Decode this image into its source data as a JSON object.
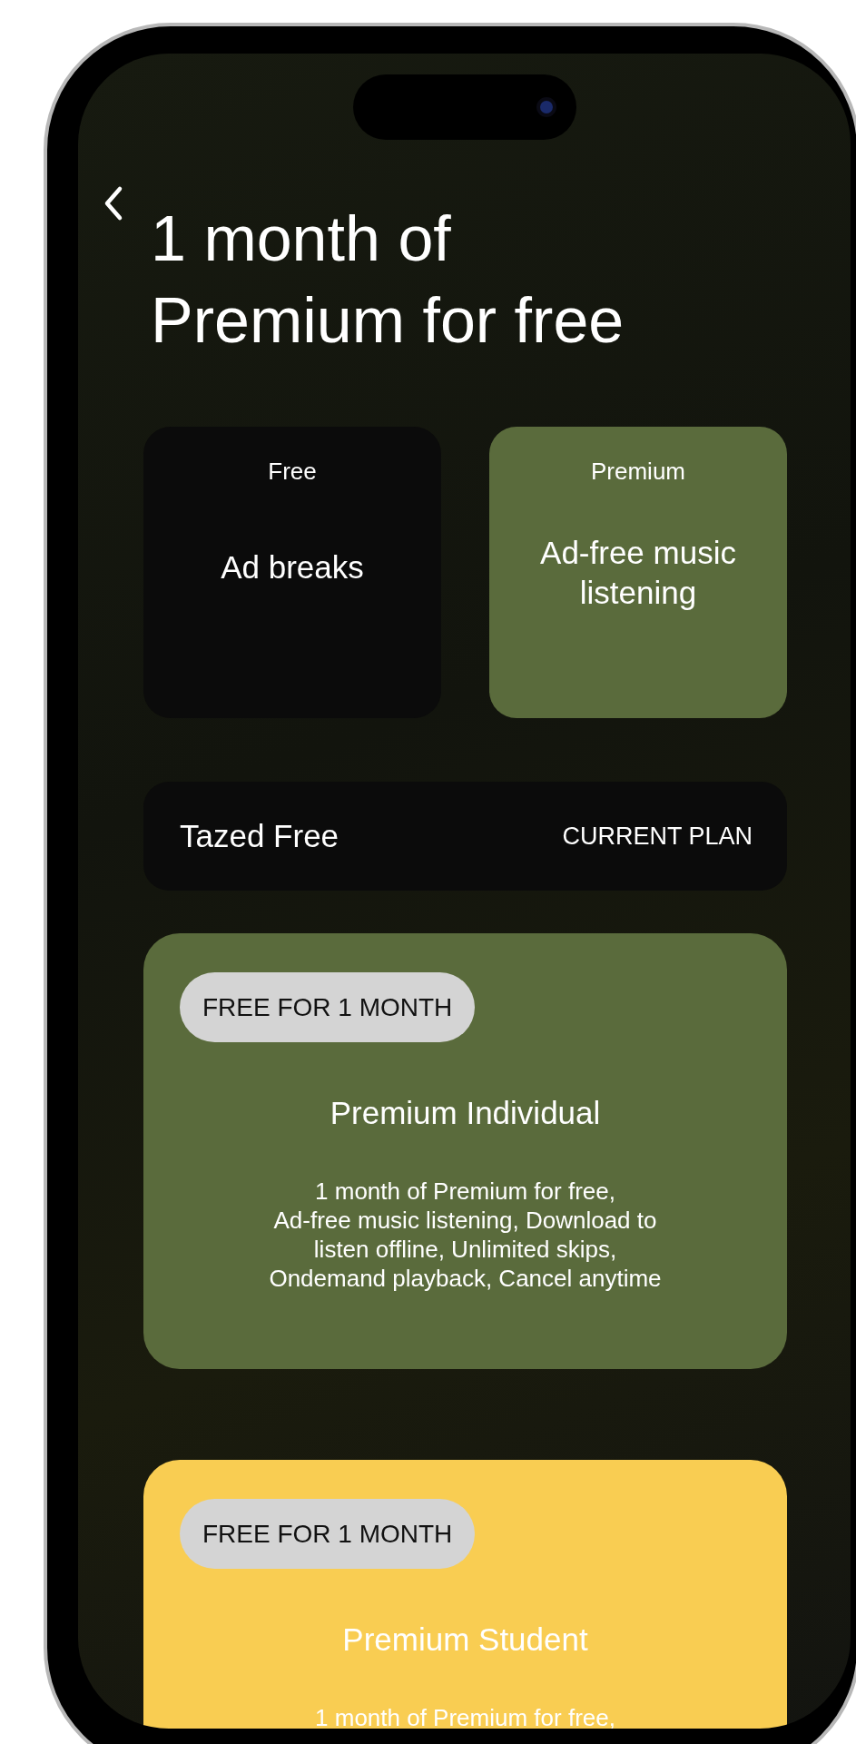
{
  "title": "1 month of\nPremium for free",
  "comparison": [
    {
      "label": "Free",
      "feature": "Ad breaks",
      "color": "#0b0b0b"
    },
    {
      "label": "Premium",
      "feature": "Ad-free music\nlistening",
      "color": "#5a6b3c"
    }
  ],
  "current_plan": {
    "name": "Tazed Free",
    "status": "CURRENT PLAN"
  },
  "offers": [
    {
      "badge": "FREE FOR 1 MONTH",
      "name": "Premium Individual",
      "description": "1 month of Premium for free,\nAd-free music listening, Download to\nlisten offline, Unlimited skips,\nOndemand playback, Cancel anytime",
      "color": "#5a6b3c"
    },
    {
      "badge": "FREE FOR 1 MONTH",
      "name": "Premium Student",
      "description": "1 month of Premium for free,",
      "color": "#f9cd52"
    }
  ]
}
